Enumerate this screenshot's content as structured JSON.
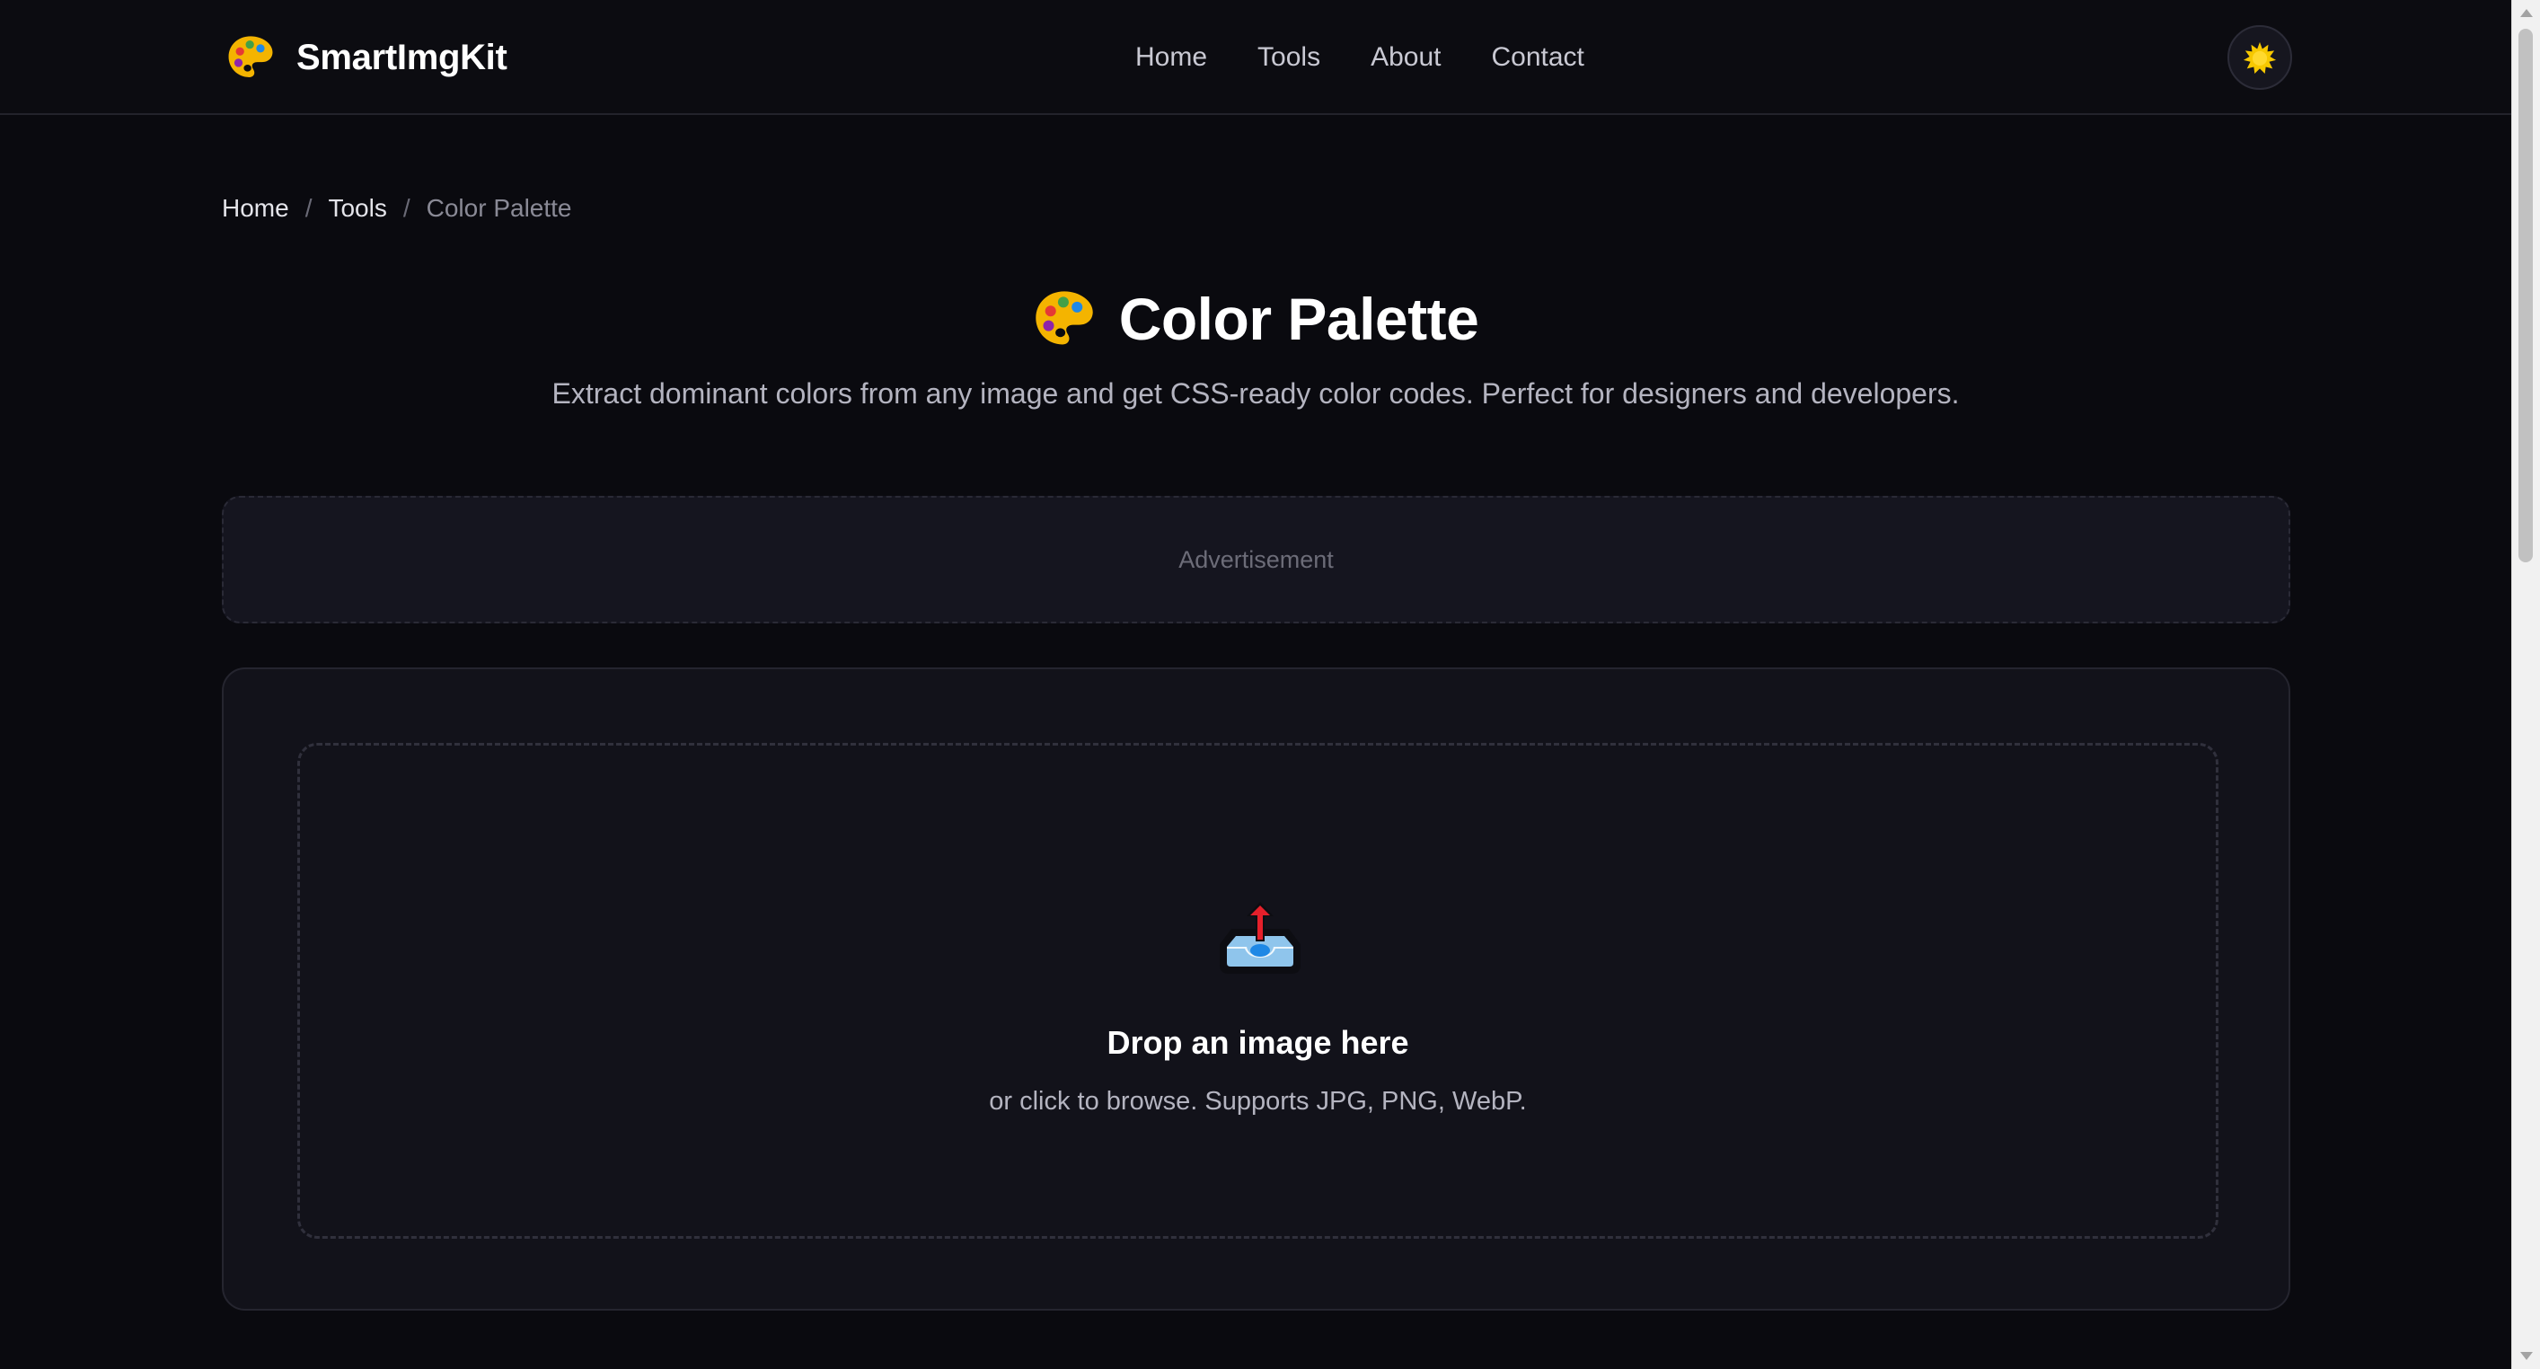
{
  "header": {
    "brand_name": "SmartImgKit",
    "brand_icon": "palette-icon",
    "nav": [
      {
        "label": "Home"
      },
      {
        "label": "Tools"
      },
      {
        "label": "About"
      },
      {
        "label": "Contact"
      }
    ],
    "theme_toggle_icon": "sun-icon"
  },
  "breadcrumb": {
    "items": [
      {
        "label": "Home"
      },
      {
        "label": "Tools"
      }
    ],
    "separator": "/",
    "current": "Color Palette"
  },
  "page": {
    "title_icon": "palette-icon",
    "title": "Color Palette",
    "subtitle": "Extract dominant colors from any image and get CSS-ready color codes. Perfect for designers and developers."
  },
  "ad": {
    "label": "Advertisement"
  },
  "upload": {
    "icon": "outbox-tray-icon",
    "title": "Drop an image here",
    "subtitle": "or click to browse. Supports JPG, PNG, WebP."
  },
  "colors": {
    "background": "#0a0a0f",
    "header": "#0c0c11",
    "card": "#12121a",
    "ad_background": "#15151f",
    "text_primary": "#ffffff",
    "text_muted": "#b4b4c0",
    "sun": "#f7c800",
    "upload_arrow": "#e5202b",
    "tray_blue": "#8fc5ec"
  }
}
